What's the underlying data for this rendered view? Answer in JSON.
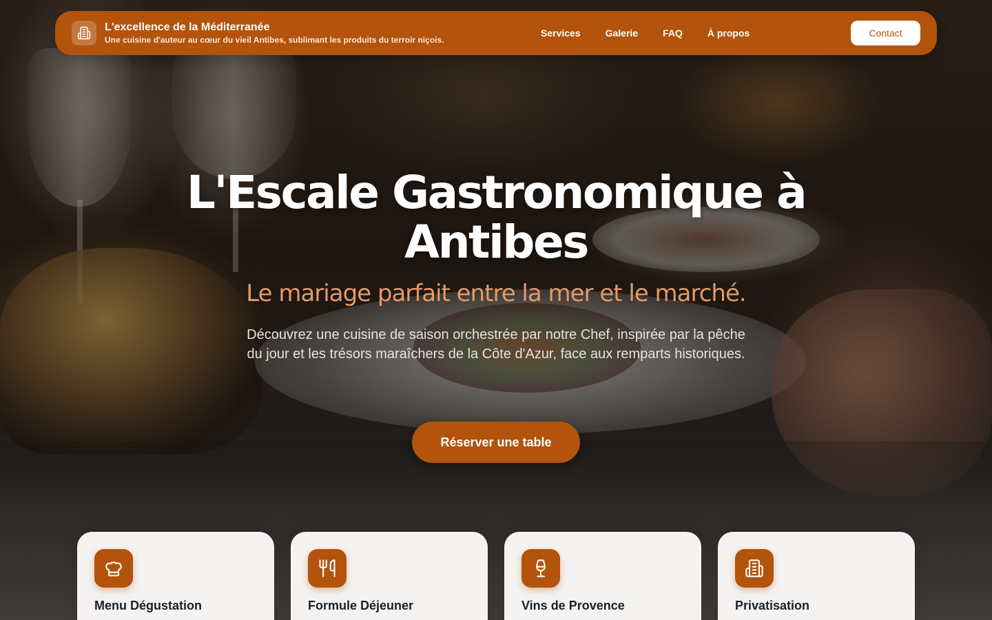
{
  "header": {
    "brand_title": "L'excellence de la Méditerranée",
    "brand_subtitle": "Une cuisine d'auteur au cœur du vieil Antibes, sublimant les produits du terroir niçois.",
    "brand_icon": "building-icon",
    "nav": [
      {
        "label": "Services"
      },
      {
        "label": "Galerie"
      },
      {
        "label": "FAQ"
      },
      {
        "label": "À propos"
      }
    ],
    "contact_label": "Contact"
  },
  "hero": {
    "title": "L'Escale Gastronomique à Antibes",
    "tagline": "Le mariage parfait entre la mer et le marché.",
    "description": "Découvrez une cuisine de saison orchestrée par notre Chef, inspirée par la pêche du jour et les trésors maraîchers de la Côte d'Azur, face aux remparts historiques.",
    "cta_label": "Réserver une table"
  },
  "services": [
    {
      "title": "Menu Dégustation",
      "icon": "chef-hat-icon"
    },
    {
      "title": "Formule Déjeuner",
      "icon": "utensils-icon"
    },
    {
      "title": "Vins de Provence",
      "icon": "wine-glass-icon"
    },
    {
      "title": "Privatisation",
      "icon": "building-icon"
    }
  ],
  "colors": {
    "accent": "#b3530c",
    "tagline": "#e39a66",
    "card_bg": "#f4f3f2",
    "text_dark": "#1f1f1f"
  }
}
